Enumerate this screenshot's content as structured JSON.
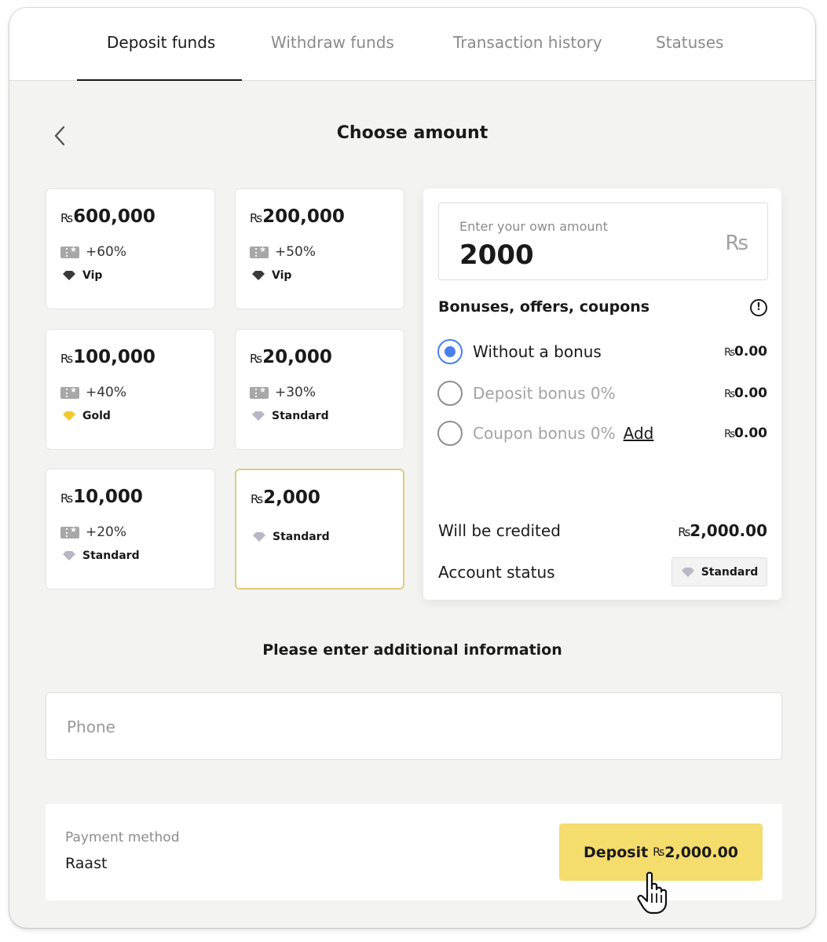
{
  "tabs": [
    {
      "label": "Deposit funds",
      "active": true
    },
    {
      "label": "Withdraw funds",
      "active": false
    },
    {
      "label": "Transaction history",
      "active": false
    },
    {
      "label": "Statuses",
      "active": false
    }
  ],
  "page_title": "Choose amount",
  "currency_symbol": "₨",
  "amount_cards": [
    {
      "amount": "600,000",
      "bonus": "+60%",
      "status": "Vip",
      "status_color": "#3a3a3a"
    },
    {
      "amount": "200,000",
      "bonus": "+50%",
      "status": "Vip",
      "status_color": "#3a3a3a"
    },
    {
      "amount": "100,000",
      "bonus": "+40%",
      "status": "Gold",
      "status_color": "#f1c92e"
    },
    {
      "amount": "20,000",
      "bonus": "+30%",
      "status": "Standard",
      "status_color": "#b8b8c4"
    },
    {
      "amount": "10,000",
      "bonus": "+20%",
      "status": "Standard",
      "status_color": "#b8b8c4"
    },
    {
      "amount": "2,000",
      "bonus": "",
      "status": "Standard",
      "status_color": "#b8b8c4",
      "selected": true
    }
  ],
  "own_amount": {
    "label": "Enter your own amount",
    "value": "2000",
    "currency": "Rs"
  },
  "bonuses": {
    "title": "Bonuses, offers, coupons",
    "info_icon": "exclamation-circle-icon",
    "options": [
      {
        "label": "Without a bonus",
        "amount": "0.00",
        "selected": true
      },
      {
        "label": "Deposit bonus 0%",
        "amount": "0.00",
        "selected": false
      },
      {
        "label": "Coupon bonus 0%",
        "amount": "0.00",
        "selected": false,
        "link": "Add"
      }
    ]
  },
  "summary": {
    "credited_label": "Will be credited",
    "credited_value": "2,000.00",
    "status_label": "Account status",
    "status_value": "Standard"
  },
  "additional_info": {
    "title": "Please enter additional information",
    "phone_placeholder": "Phone"
  },
  "payment": {
    "method_label": "Payment method",
    "method_value": "Raast",
    "button_prefix": "Deposit",
    "button_amount": "2,000.00"
  },
  "colors": {
    "accent_yellow": "#f4dc6d",
    "selected_border": "#e0cd7c",
    "radio_blue": "#4a7ff0"
  }
}
